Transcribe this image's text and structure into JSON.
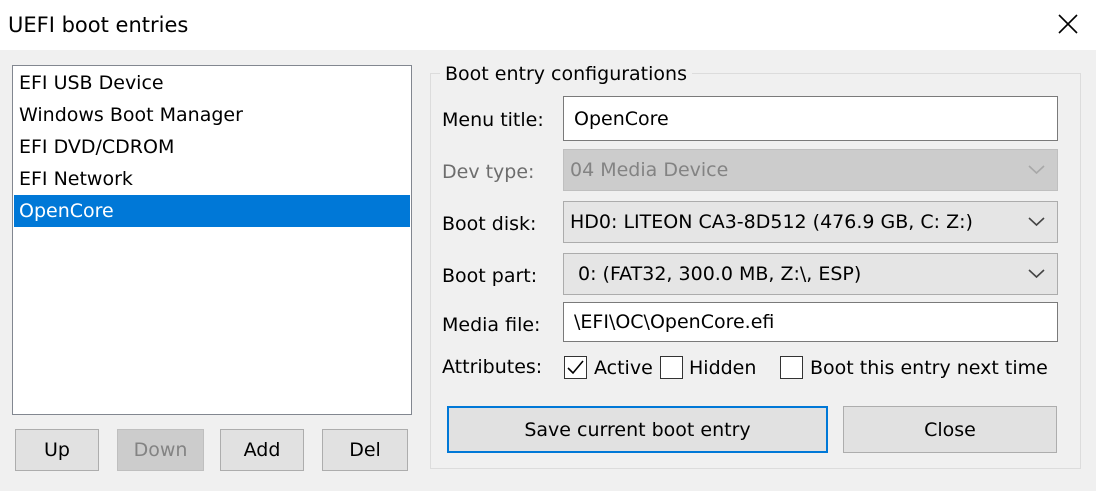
{
  "window": {
    "title": "UEFI boot entries",
    "close_icon": "close-icon"
  },
  "boot_list": {
    "items": [
      {
        "label": "EFI USB Device",
        "selected": false
      },
      {
        "label": "Windows Boot Manager",
        "selected": false
      },
      {
        "label": "EFI DVD/CDROM",
        "selected": false
      },
      {
        "label": "EFI Network",
        "selected": false
      },
      {
        "label": "OpenCore",
        "selected": true
      }
    ],
    "selection_color": "#0078d7"
  },
  "list_buttons": {
    "up": "Up",
    "down": "Down",
    "add": "Add",
    "del": "Del"
  },
  "config": {
    "group_title": "Boot entry configurations",
    "menu_title_label": "Menu title:",
    "menu_title_value": "OpenCore",
    "dev_type_label": "Dev type:",
    "dev_type_value": "04  Media Device",
    "boot_disk_label": "Boot disk:",
    "boot_disk_value": "HD0: LITEON CA3-8D512 (476.9 GB, C: Z:)",
    "boot_part_label": "Boot part:",
    "boot_part_value": "0: (FAT32, 300.0 MB, Z:\\, ESP)",
    "media_file_label": "Media file:",
    "media_file_value": "\\EFI\\OC\\OpenCore.efi",
    "attributes_label": "Attributes:",
    "attr_active": "Active",
    "attr_active_checked": true,
    "attr_hidden": "Hidden",
    "attr_hidden_checked": false,
    "attr_next": "Boot this entry next time",
    "attr_next_checked": false
  },
  "actions": {
    "save": "Save current boot entry",
    "close": "Close"
  }
}
